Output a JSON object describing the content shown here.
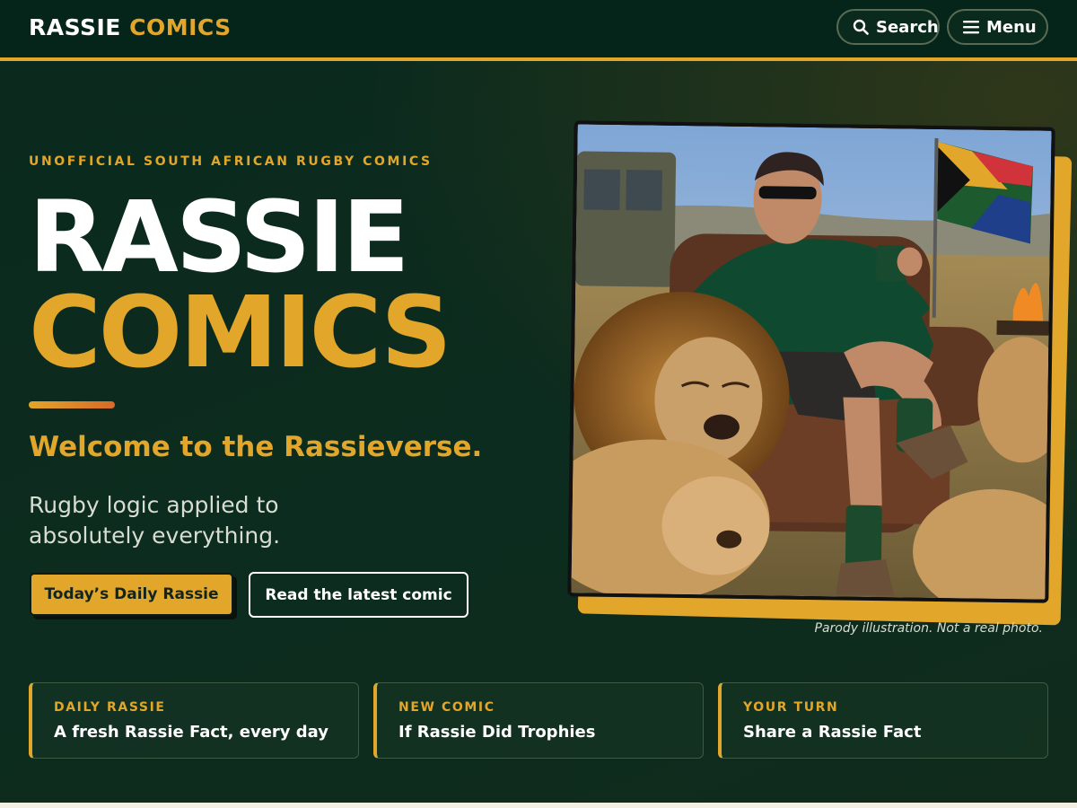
{
  "header": {
    "brand_part1": "RASSIE",
    "brand_part2": "COMICS",
    "search_label": "Search",
    "menu_label": "Menu"
  },
  "hero": {
    "eyebrow": "UNOFFICIAL SOUTH AFRICAN RUGBY COMICS",
    "title_line1": "RASSIE",
    "title_line2": "COMICS",
    "welcome": "Welcome to the Rassieverse.",
    "lead": "Rugby logic applied to absolutely everything.",
    "primary_button": "Today’s Daily Rassie",
    "secondary_button": "Read the latest comic",
    "image_caption": "Parody illustration. Not a real photo."
  },
  "cards": [
    {
      "kicker": "DAILY RASSIE",
      "title": "A fresh Rassie Fact, every day"
    },
    {
      "kicker": "NEW COMIC",
      "title": "If Rassie Did Trophies"
    },
    {
      "kicker": "YOUR TURN",
      "title": "Share a Rassie Fact"
    }
  ],
  "colors": {
    "accent": "#e2a62a",
    "background": "#0c2a1d",
    "text": "#ffffff"
  },
  "icons": {
    "search": "search-icon",
    "menu": "hamburger-menu-icon"
  }
}
